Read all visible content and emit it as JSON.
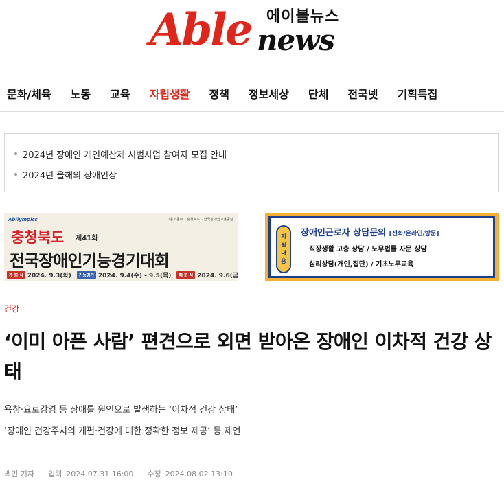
{
  "logo": {
    "able": "Able",
    "news": "news",
    "korean": "에이블뉴스"
  },
  "nav": {
    "items": [
      "문화/체육",
      "노동",
      "교육",
      "자립생활",
      "정책",
      "정보세상",
      "단체",
      "전국넷",
      "기획특집"
    ],
    "active_index": 3
  },
  "notices": [
    "2024년 장애인 개인예산제 시범사업 참여자 모집 안내",
    "2024년 올해의 장애인상"
  ],
  "banner_left": {
    "badge": "Abilympics",
    "orgs": "고용노동부 · 충청북도 · 한국장애인고용공단",
    "region": "충청북도",
    "edition": "제41회",
    "title": "전국장애인기능경기대회",
    "opening_tag": "개 회 식",
    "opening_date": "2024. 9.3(화)",
    "contest_tag": "기능경기",
    "contest_date": "2024. 9.4(수) - 9.5(목)",
    "closing_tag": "폐 회 식",
    "closing_date": "2024. 9.6(금)"
  },
  "banner_right": {
    "side": [
      "지",
      "원",
      "내",
      "용"
    ],
    "title": "장애인근로자 상담문의",
    "title_sub": "[전화/온라인/방문]",
    "line1": "직장생활 고충 상담 / 노무법률 자문 상담",
    "line2": "심리상담(개인,집단) / 기초노무교육"
  },
  "article": {
    "category": "건강",
    "headline": "‘이미 아픈 사람’ 편견으로 외면 받아온 장애인 이차적 건강 상태",
    "subtitles": [
      "욕창·요로감염 등 장애를 원인으로 발생하는 ‘이차적 건강 상태’",
      "‘장애인 건강주치의 개편·건강에 대한 정확한 정보 제공’ 등 제언"
    ],
    "author": "백민 기자",
    "published_label": "입력",
    "published": "2024.07.31 16:00",
    "modified_label": "수정",
    "modified": "2024.08.02 13:10"
  },
  "colors": {
    "accent": "#e1251b",
    "banner_blue": "#1e3f8f",
    "banner_yellow": "#f4b030"
  }
}
